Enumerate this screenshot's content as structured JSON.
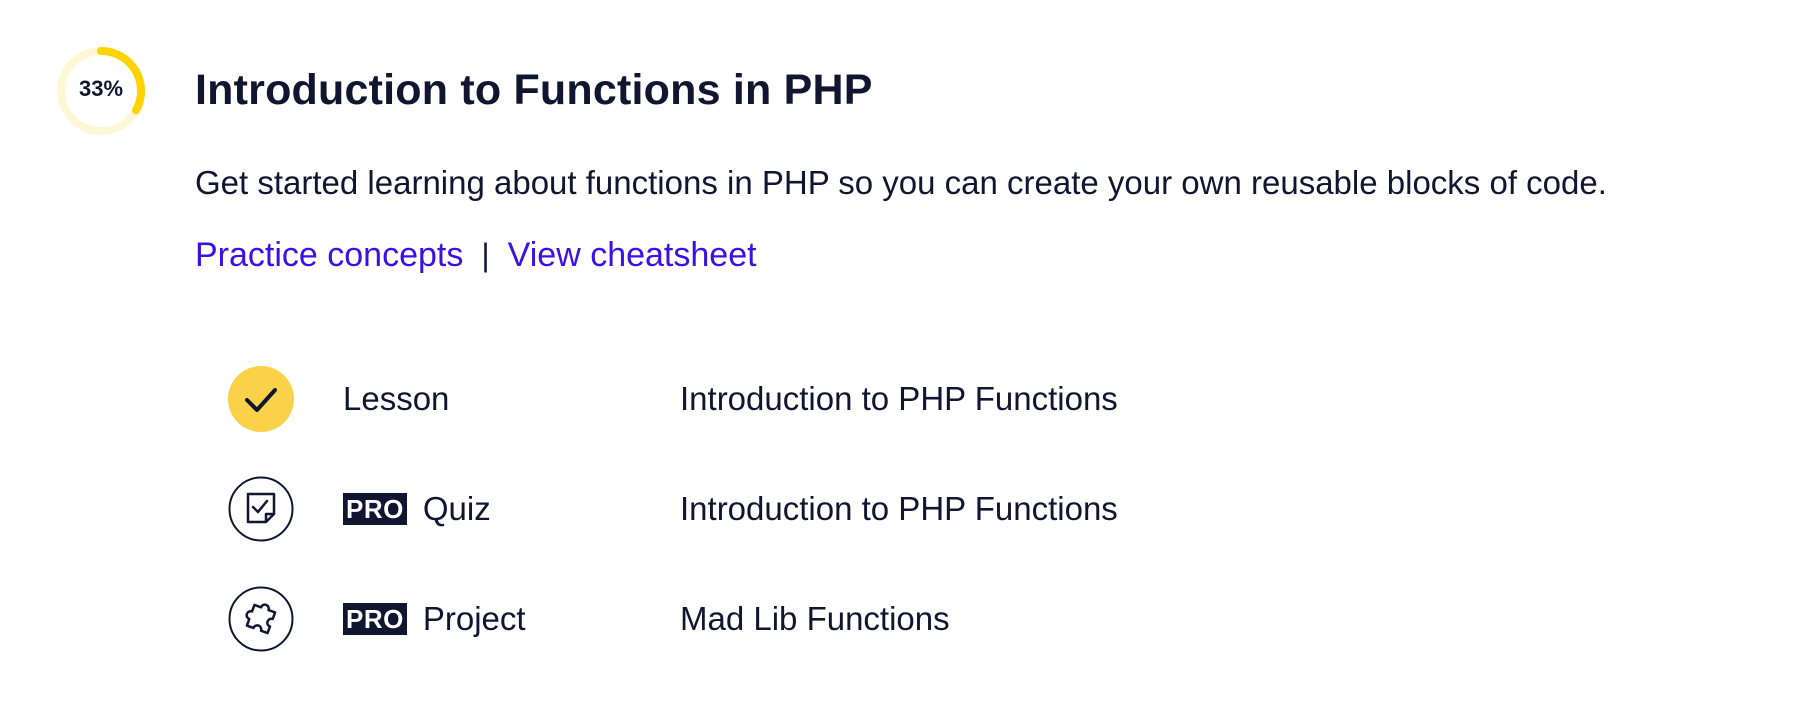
{
  "module": {
    "progress": {
      "label": "33%",
      "fraction": 0.33,
      "color_fill": "#ffd300",
      "color_track": "#fff6d6"
    },
    "title": "Introduction to Functions in PHP",
    "description": "Get started learning about functions in PHP so you can create your own reusable blocks of code.",
    "links": {
      "practice": "Practice concepts",
      "separator": "|",
      "cheatsheet": "View cheatsheet"
    },
    "items": [
      {
        "status": "completed",
        "icon": "checkmark-icon",
        "pro": false,
        "type": "Lesson",
        "name": "Introduction to PHP Functions"
      },
      {
        "status": "not-started",
        "icon": "quiz-icon",
        "pro": true,
        "pro_label": "PRO",
        "type": "Quiz",
        "name": "Introduction to PHP Functions"
      },
      {
        "status": "not-started",
        "icon": "puzzle-icon",
        "pro": true,
        "pro_label": "PRO",
        "type": "Project",
        "name": "Mad Lib Functions"
      }
    ]
  },
  "colors": {
    "text": "#10162f",
    "link": "#3a10e5",
    "accent": "#ffd300"
  }
}
